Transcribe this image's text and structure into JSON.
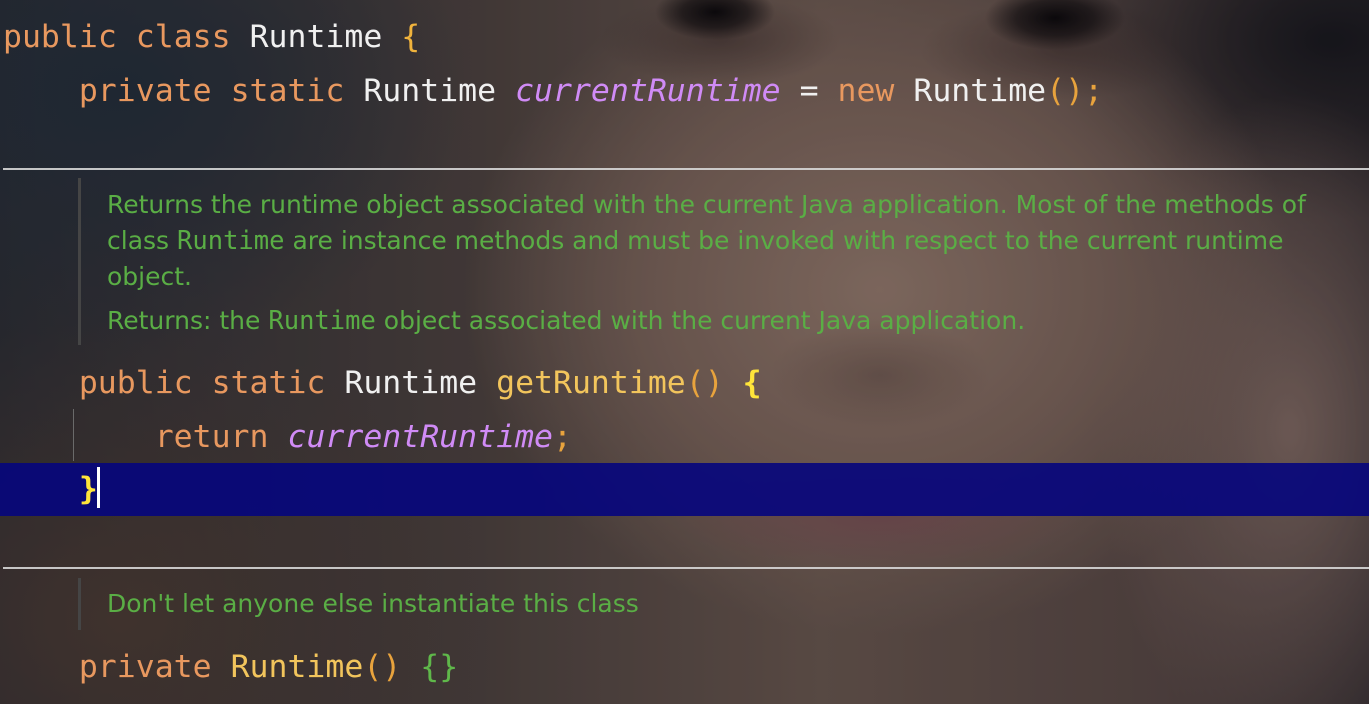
{
  "colors": {
    "keyword": "#e8985f",
    "identifier": "#f0f0f0",
    "field": "#d08bf6",
    "method": "#f2c55c",
    "punctuation": "#e8a33d",
    "brace": "#f0b33c",
    "brace_match": "#ffe53a",
    "inner_brace": "#5fb84a",
    "doc_text": "#5aae45",
    "caret": "#ffffff"
  },
  "editor": {
    "class_decl": {
      "modifier": "public",
      "keyword": "class",
      "name": "Runtime",
      "open_brace": "{"
    },
    "field_decl": {
      "modifier": "private",
      "static": "static",
      "type": "Runtime",
      "name": "currentRuntime",
      "assign": "=",
      "new": "new",
      "ctor": "Runtime",
      "call": "();"
    },
    "get_runtime_doc": {
      "line1": "Returns the runtime object associated with the current Java application. Most of the methods of",
      "line2_pre": "class",
      "line2_code": "Runtime",
      "line2_post": "are instance methods and must be invoked with respect to the current runtime",
      "line3": "object.",
      "returns_label": "Returns:",
      "returns_pre": "the",
      "returns_code": "Runtime",
      "returns_post": "object associated with the current Java application."
    },
    "get_runtime_method": {
      "modifier": "public",
      "static": "static",
      "return_type": "Runtime",
      "name": "getRuntime",
      "parens": "()",
      "open_brace": "{"
    },
    "return_stmt": {
      "keyword": "return",
      "value": "currentRuntime",
      "semicolon": ";"
    },
    "close_brace": "}",
    "ctor_doc": "Don't let anyone else instantiate this class",
    "ctor_decl": {
      "modifier": "private",
      "name": "Runtime",
      "parens": "()",
      "body": "{}"
    }
  }
}
